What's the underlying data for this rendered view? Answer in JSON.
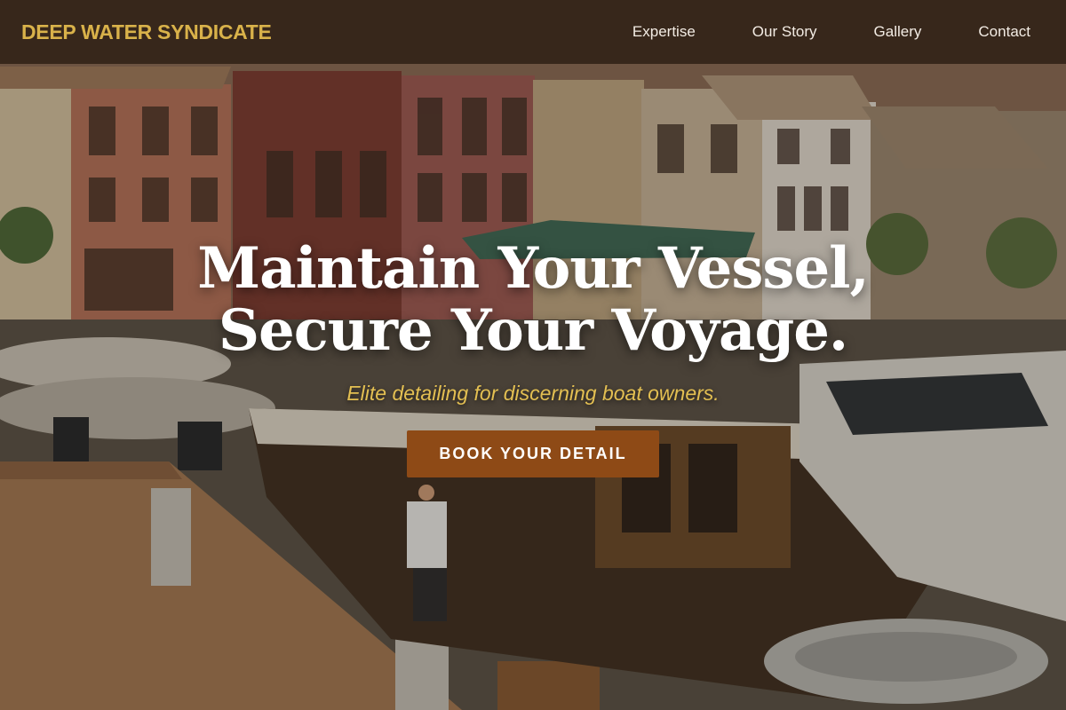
{
  "nav": {
    "brand": "DEEP WATER SYNDICATE",
    "links": [
      "Expertise",
      "Our Story",
      "Gallery",
      "Contact"
    ]
  },
  "hero": {
    "headline_line1": "Maintain Your Vessel,",
    "headline_line2": "Secure Your Voyage.",
    "subheadline": "Elite detailing for discerning boat owners.",
    "cta_label": "BOOK YOUR DETAIL",
    "background_description": "marina-with-moored-boats-and-harbor-buildings"
  },
  "colors": {
    "nav_background": "#342418",
    "brand_gold": "#d9b24a",
    "subheadline_gold": "#e3bf52",
    "cta_background": "#8e4a16",
    "headline_text": "#ffffff",
    "nav_text": "#f3ece4"
  }
}
